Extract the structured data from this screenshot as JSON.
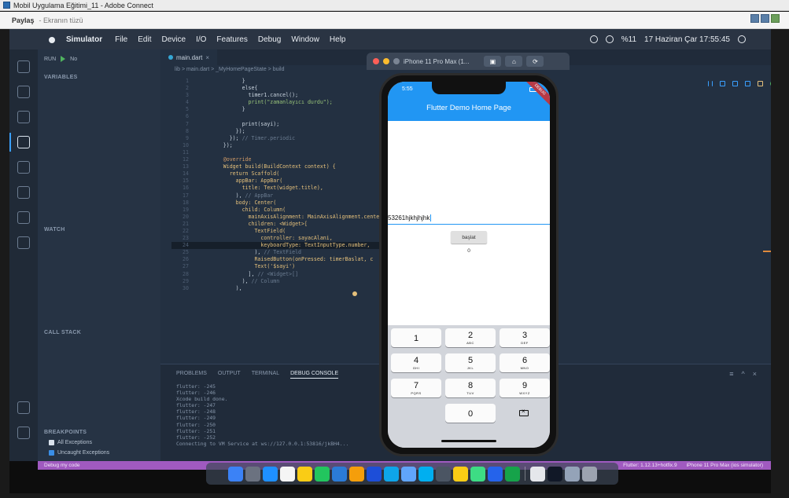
{
  "adobe": {
    "window_title": "Mobil Uygulama Eğitimi_11 - Adobe Connect",
    "share_label": "Paylaş",
    "share_meta": "- Ekranın tüzü"
  },
  "menubar": {
    "app_name": "Simulator",
    "items": [
      "File",
      "Edit",
      "Device",
      "I/O",
      "Features",
      "Debug",
      "Window",
      "Help"
    ],
    "battery": "%11",
    "datetime": "17 Haziran Çar 17:55:45"
  },
  "vscode": {
    "run_label": "RUN",
    "run_config": "No",
    "sections": {
      "variables": "VARIABLES",
      "watch": "WATCH",
      "call_stack": "CALL STACK",
      "breakpoints": "BREAKPOINTS"
    },
    "breakpoints": [
      {
        "label": "All Exceptions",
        "checked": false
      },
      {
        "label": "Uncaught Exceptions",
        "checked": true
      }
    ],
    "tab": "main.dart",
    "breadcrumb": "lib > main.dart > _MyHomePageState > build",
    "code_lines": [
      "              }",
      "              else{",
      "                timer1.cancel();",
      "                print(\"zamanlayıcı durdu\");",
      "              }",
      "",
      "              print(sayi);",
      "            });",
      "          }); // Timer.periodic",
      "        });",
      "",
      "        @override",
      "        Widget build(BuildContext context) {",
      "          return Scaffold(",
      "            appBar: AppBar(",
      "              title: Text(widget.title),",
      "            ), // AppBar",
      "            body: Center(",
      "              child: Column(",
      "                mainAxisAlignment: MainAxisAlignment.center,",
      "                children: <Widget>[",
      "                  TextField(",
      "                    controller: sayacAlani,",
      "                    keyboardType: TextInputType.number,",
      "                  ), // TextField",
      "                  RaisedButton(onPressed: timerBaslat, c",
      "                  Text('$sayi')",
      "                ], // <Widget>[]",
      "              ), // Column",
      "            ),"
    ],
    "panel_tabs": [
      "PROBLEMS",
      "OUTPUT",
      "TERMINAL",
      "DEBUG CONSOLE"
    ],
    "console_lines": [
      "flutter: -245",
      "flutter: -246",
      "Xcode build done.",
      "flutter: -247",
      "flutter: -248",
      "flutter: -249",
      "flutter: -250",
      "flutter: -251",
      "flutter: -252",
      "Connecting to VM Service at ws://127.0.0.1:53816/jkBH4..."
    ],
    "status_left": "Debug my code",
    "status_right": [
      "Flutter: 1.12.13+hotfix.9",
      "iPhone 11 Pro Max (ios simulator)"
    ]
  },
  "simulator": {
    "window_title": "iPhone 11 Pro Max (1...",
    "status_time": "5:55",
    "debug_ribbon": "DEBUG",
    "app_title": "Flutter Demo Home Page",
    "textfield_value": "53261hjkhjhjhk",
    "button_label": "başlat",
    "counter": "0",
    "keys": [
      {
        "num": "1",
        "letters": ""
      },
      {
        "num": "2",
        "letters": "ABC"
      },
      {
        "num": "3",
        "letters": "DEF"
      },
      {
        "num": "4",
        "letters": "GHI"
      },
      {
        "num": "5",
        "letters": "JKL"
      },
      {
        "num": "6",
        "letters": "MNO"
      },
      {
        "num": "7",
        "letters": "PQRS"
      },
      {
        "num": "8",
        "letters": "TUV"
      },
      {
        "num": "9",
        "letters": "WXYZ"
      },
      {
        "num": "0",
        "letters": ""
      }
    ]
  },
  "colors": {
    "appbar": "#2196f3",
    "statusbar": "#a05ac0",
    "editor_bg": "#233041"
  }
}
